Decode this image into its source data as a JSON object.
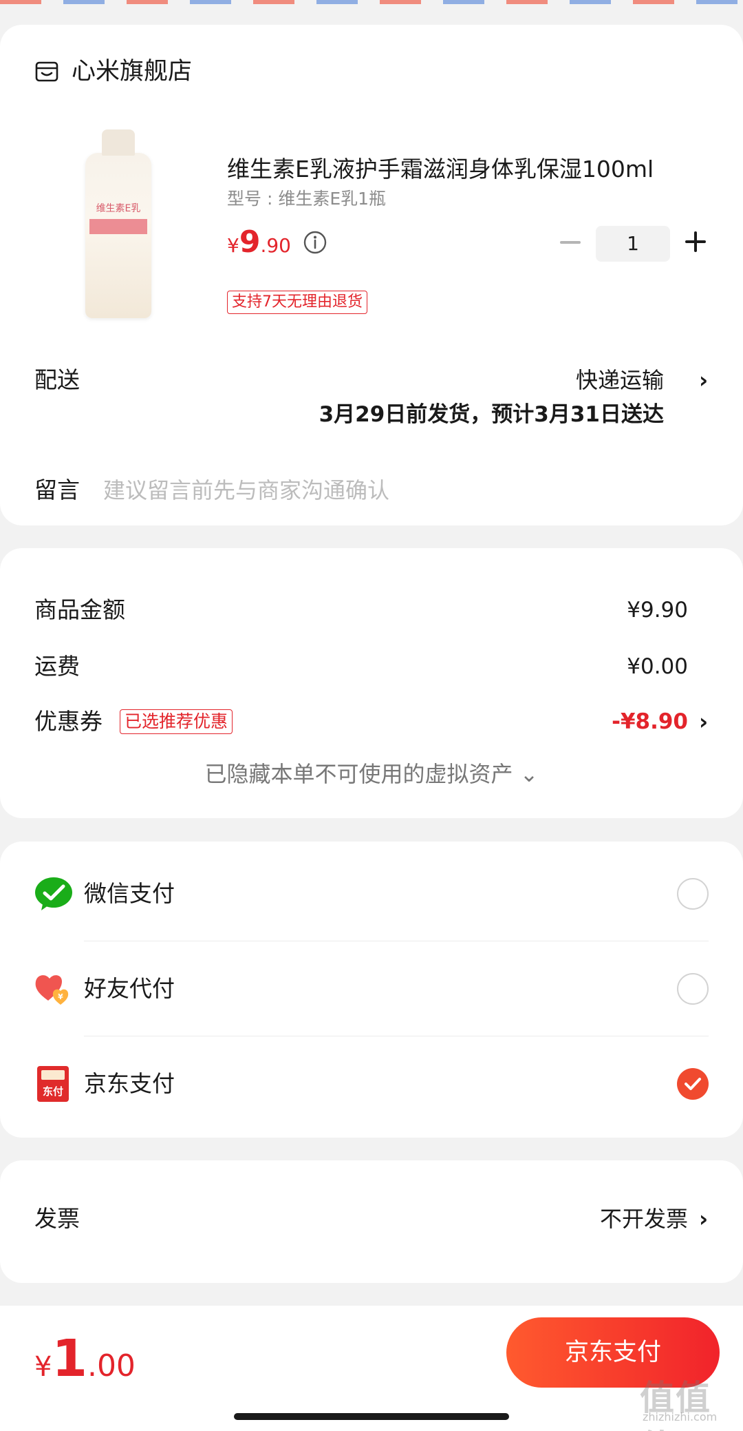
{
  "store": {
    "name": "心米旗舰店",
    "icon": "store-icon"
  },
  "product": {
    "title": "维生素E乳液护手霜滋润身体乳保湿100ml",
    "spec": "型号 : 维生素E乳1瓶",
    "price_currency": "¥",
    "price_int": "9",
    "price_dec": ".90",
    "quantity": "1",
    "return_policy": "支持7天无理由退货",
    "image_label": "维生素E乳"
  },
  "delivery": {
    "label": "配送",
    "method": "快递运输",
    "date": "3月29日前发货，预计3月31日送达"
  },
  "message": {
    "label": "留言",
    "placeholder": "建议留言前先与商家沟通确认"
  },
  "amounts": {
    "goods_label": "商品金额",
    "goods_value": "¥9.90",
    "shipping_label": "运费",
    "shipping_value": "¥0.00",
    "coupon_label": "优惠券",
    "coupon_badge": "已选推荐优惠",
    "coupon_value": "-¥8.90",
    "hidden_assets": "已隐藏本单不可使用的虚拟资产 ⌄"
  },
  "payment": {
    "methods": [
      {
        "label": "微信支付",
        "icon": "wechat-pay-icon",
        "selected": false
      },
      {
        "label": "好友代付",
        "icon": "friend-pay-icon",
        "selected": false
      },
      {
        "label": "京东支付",
        "icon": "jd-pay-icon",
        "selected": true
      }
    ],
    "jd_icon_text": "东付"
  },
  "invoice": {
    "label": "发票",
    "value": "不开发票"
  },
  "footer": {
    "total_currency": "¥",
    "total_int": "1",
    "total_dec": ".00",
    "pay_button": "京东支付",
    "watermark": "值值值",
    "watermark_url": "zhizhizhi.com"
  },
  "colors": {
    "accent": "#e3242b",
    "button_start": "#ff5a2e",
    "button_end": "#f1232b",
    "check": "#f04a2f",
    "wechat": "#1aad19"
  }
}
